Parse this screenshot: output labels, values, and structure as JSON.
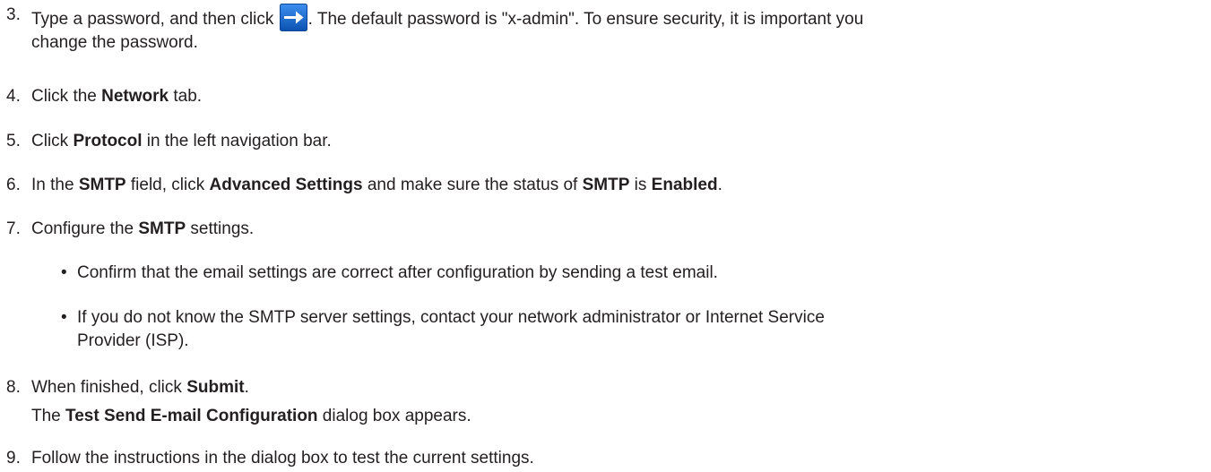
{
  "steps": {
    "s3": {
      "num": "3.",
      "before": "Type a password, and then click",
      "icon": "login-arrow-icon",
      "after": ". The default password is \"x-admin\". To ensure security, it is important you",
      "line2": "change the password."
    },
    "s4": {
      "num": "4.",
      "a": "Click the ",
      "b": "Network",
      "c": " tab."
    },
    "s5": {
      "num": "5.",
      "a": "Click ",
      "b": "Protocol",
      "c": " in the left navigation bar."
    },
    "s6": {
      "num": "6.",
      "a": "In the ",
      "b": "SMTP",
      "c": " field, click ",
      "d": "Advanced Settings",
      "e": " and make sure the status of ",
      "f": "SMTP",
      "g": " is ",
      "h": "Enabled",
      "i": "."
    },
    "s7": {
      "num": "7.",
      "a": "Configure the ",
      "b": "SMTP",
      "c": " settings.",
      "bullets": [
        "Confirm that the email settings are correct after configuration by sending a test email.",
        "If you do not know the SMTP server settings, contact your network administrator or Internet Service",
        "Provider (ISP)."
      ],
      "bullet_char": "•"
    },
    "s8": {
      "num": "8.",
      "a": "When finished, click ",
      "b": "Submit",
      "c": ".",
      "sub_b": "Test Send E-mail Configuration",
      "sub_c": " dialog box appears.",
      "sub_a": "The "
    },
    "s9": {
      "num": "9.",
      "a": "Follow the instructions in the dialog box to test the current settings."
    }
  },
  "colors": {
    "text": "#231f20",
    "icon_blue": "#1a6fd1",
    "icon_blue_dark": "#0d4fa8"
  }
}
